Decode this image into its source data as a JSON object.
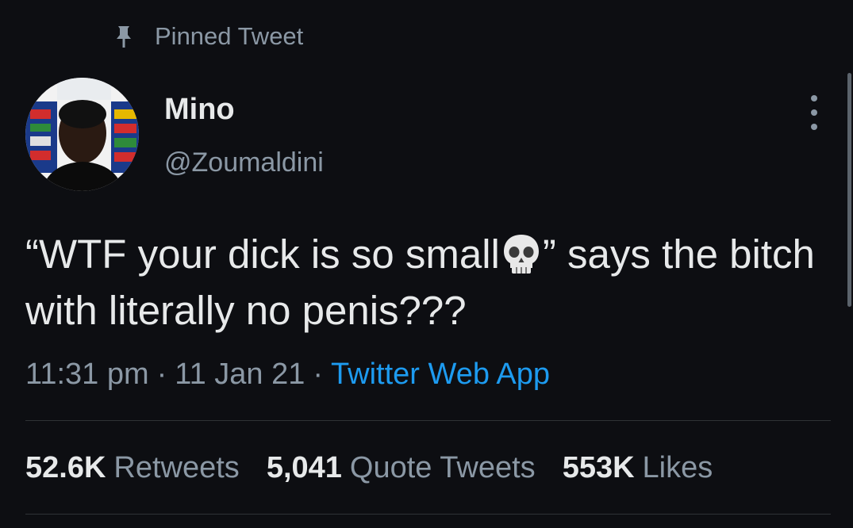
{
  "pinned": {
    "label": "Pinned Tweet",
    "icon": "pin-icon"
  },
  "user": {
    "name": "Mino",
    "handle": "@Zoumaldini",
    "avatar_icon": "profile-photo"
  },
  "tweet": {
    "text_before_emoji": "“WTF your dick is so small",
    "emoji": "skull-emoji",
    "text_after_emoji": "” says the bitch with literally no penis???"
  },
  "meta": {
    "time": "11:31 pm",
    "date": "11 Jan 21",
    "separator": "·",
    "source": "Twitter Web App"
  },
  "stats": {
    "retweets": {
      "count": "52.6K",
      "label": "Retweets"
    },
    "quotes": {
      "count": "5,041",
      "label": "Quote Tweets"
    },
    "likes": {
      "count": "553K",
      "label": "Likes"
    }
  },
  "colors": {
    "background": "#0d0e12",
    "text": "#e7e9ea",
    "muted": "#8b98a5",
    "link": "#1d9bf0",
    "divider": "#2f3336"
  }
}
